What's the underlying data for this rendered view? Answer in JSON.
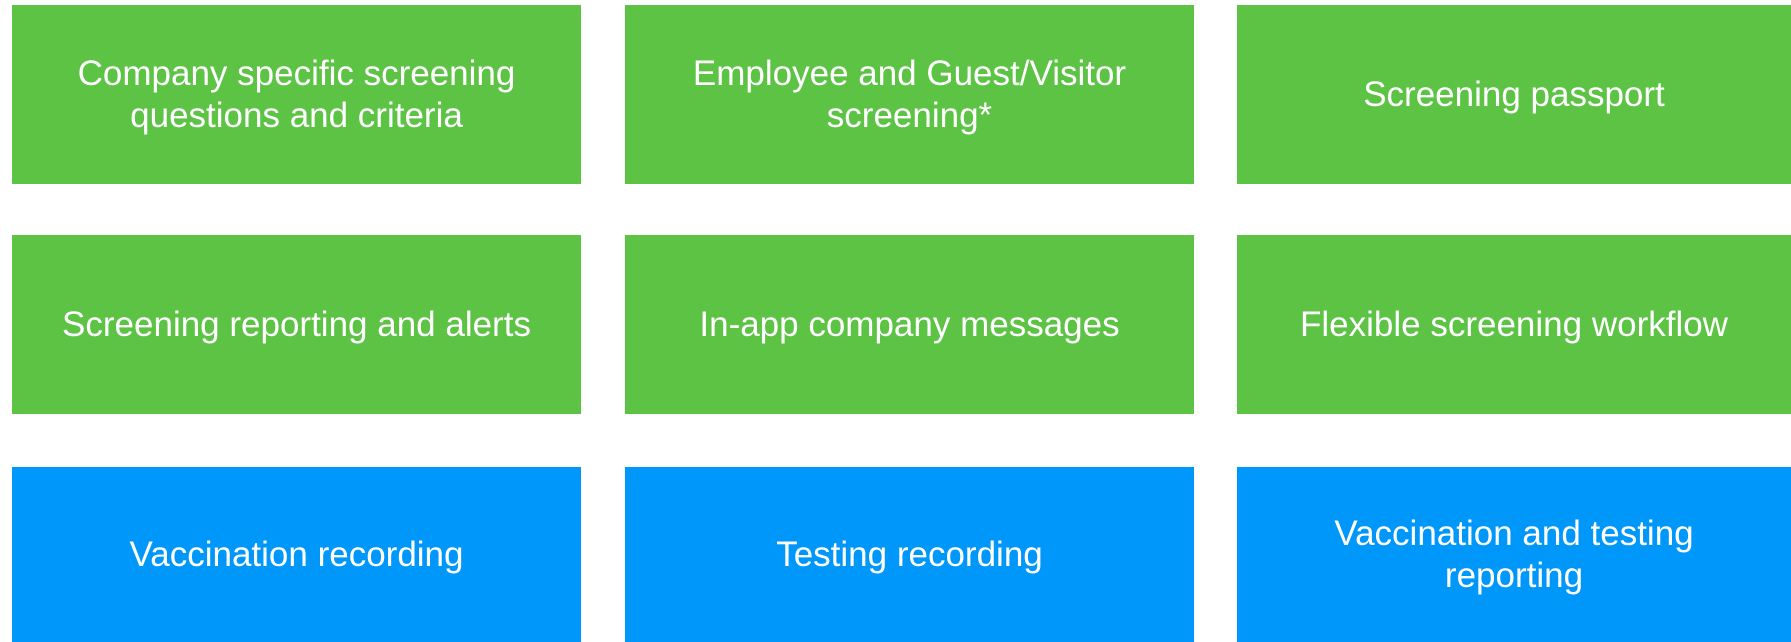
{
  "features": {
    "rows": [
      {
        "tiles": [
          {
            "label": "Company specific screening questions and criteria",
            "color": "#5cc345"
          },
          {
            "label": "Employee and Guest/Visitor screening*",
            "color": "#5cc345"
          },
          {
            "label": "Screening passport",
            "color": "#5cc345"
          }
        ]
      },
      {
        "tiles": [
          {
            "label": "Screening reporting and alerts",
            "color": "#5cc345"
          },
          {
            "label": "In-app company messages",
            "color": "#5cc345"
          },
          {
            "label": "Flexible screening workflow",
            "color": "#5cc345"
          }
        ]
      },
      {
        "tiles": [
          {
            "label": "Vaccination recording",
            "color": "#0097fb"
          },
          {
            "label": "Testing recording",
            "color": "#0097fb"
          },
          {
            "label": "Vaccination and testing reporting",
            "color": "#0097fb"
          }
        ]
      }
    ]
  }
}
